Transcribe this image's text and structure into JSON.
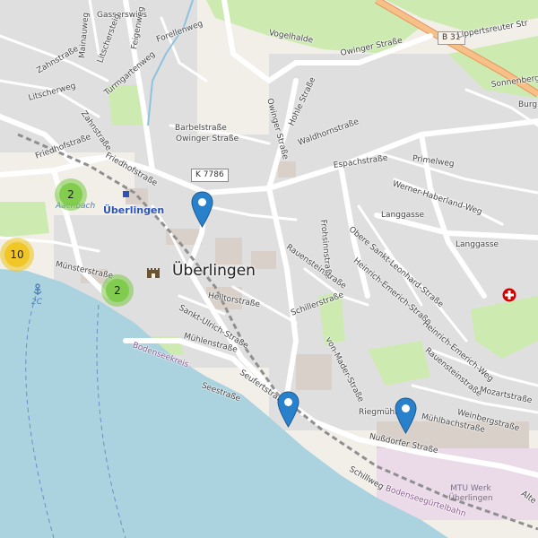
{
  "map": {
    "city_name": "Überlingen",
    "station_name": "Überlingen",
    "shields": {
      "b31": "B 31",
      "k7786": "K 7786"
    },
    "streets": {
      "gasserswies": "Gasserswies",
      "mainauweg": "Mainauweg",
      "zahnstrasse1": "Zahnstraße",
      "litschersteig": "Litschersteig",
      "feigenweg": "Feigenweg",
      "forellenweg": "Forellenweg",
      "turmgartenweg": "Turmgartenweg",
      "litscherweg": "Litscherweg",
      "zahnstrasse2": "Zahnstraße",
      "friedhofstrasse1": "Friedhofstraße",
      "friedhofstrasse2": "Friedhofstraße",
      "barbelstrasse": "Barbelstraße",
      "owinger1": "Owinger Straße",
      "owinger2": "Owinger Straße",
      "owinger3": "Owinger Straße",
      "owinger4": "Owinger Straße",
      "vogelhalde": "Vogelhalde",
      "lipperts": "Lippertsreuter Str",
      "sonnenberg": "Sonnenberg",
      "burgberg": "Burgb",
      "hohle": "Hohle Straße",
      "waldhorn": "Waldhornstraße",
      "espach": "Espachstraße",
      "primel": "Primelweg",
      "hebel": "Werner-Haberland-Weg",
      "langgasse1": "Langgasse",
      "langgasse2": "Langgasse",
      "frohsinn": "Frohsinnstraße",
      "oberesankt": "Obere Sankt-Leonhard-Straße",
      "heinrichemerich1": "Heinrich-Emerich-Straße",
      "heinrichemerich2": "Heinrich-Emerich-Weg",
      "rauenstein1": "Rauensteinstraße",
      "rauenstein2": "Rauensteinstraße",
      "helltor": "Helltorstraße",
      "sanktulrich": "Sankt-Ulrich-Straße",
      "schiller": "Schillerstraße",
      "vonmader": "von-Mader-Straße",
      "muenster": "Münsterstraße",
      "muehlen": "Mühlenstraße",
      "seufert": "Seufertstraße",
      "see": "Seestraße",
      "riegmuehle": "Riegmühle",
      "muehlbach": "Mühlbachstraße",
      "mozart": "Mozartstraße",
      "weinberg": "Weinbergstraße",
      "nussdorfer": "Nußdorfer Straße",
      "schillweg": "Schillweg",
      "alte": "Alte",
      "bodensee1": "Bodenseekreis",
      "bodensee2": "Bodenseegürtelbahn"
    },
    "water_labels": {
      "aach": "Aachbach",
      "ferry": "2C"
    },
    "industrial_label": "MTU Werk\nÜberlingen",
    "clusters": [
      {
        "count": "10",
        "color": "#f0c419"
      },
      {
        "count": "2",
        "color": "#7ac943"
      },
      {
        "count": "2",
        "color": "#7ac943"
      }
    ],
    "pin_color": "#2a81cb",
    "colors": {
      "land": "#f2efe9",
      "water": "#aad3df",
      "residential": "#e0dfdf",
      "green": "#cdebb0",
      "motorway": "#f7c088"
    },
    "icons": [
      "castle-icon",
      "hospital-icon",
      "anchor-icon",
      "map-pin-icon"
    ]
  }
}
